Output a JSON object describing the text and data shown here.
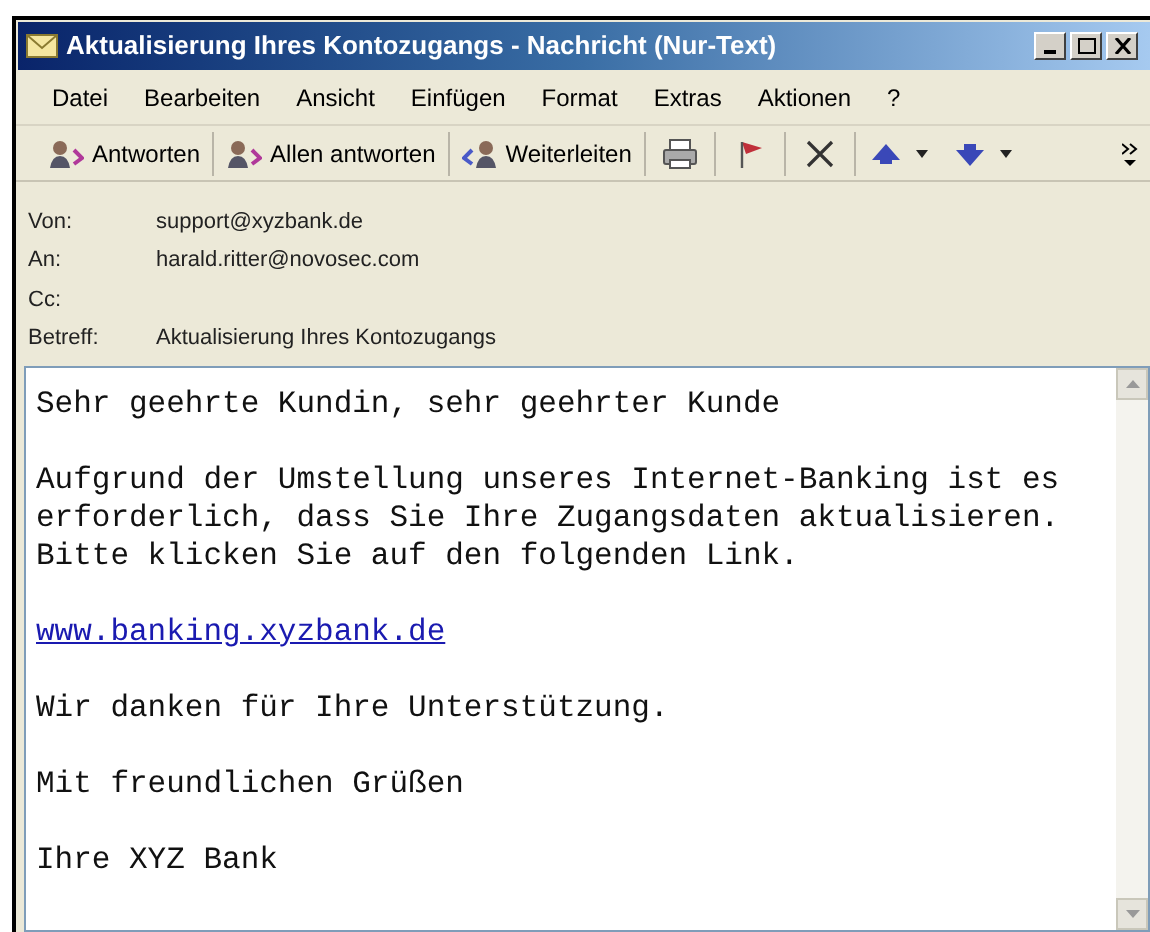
{
  "window": {
    "title": "Aktualisierung Ihres Kontozugangs - Nachricht (Nur-Text)"
  },
  "menu": [
    "Datei",
    "Bearbeiten",
    "Ansicht",
    "Einfügen",
    "Format",
    "Extras",
    "Aktionen",
    "?"
  ],
  "toolbar": [
    {
      "kind": "text",
      "label": "Antworten"
    },
    {
      "kind": "text",
      "label": "Allen antworten"
    },
    {
      "kind": "text",
      "label": "Weiterleiten"
    },
    {
      "kind": "icon"
    },
    {
      "kind": "icon"
    },
    {
      "kind": "icon"
    },
    {
      "kind": "dropdown"
    },
    {
      "kind": "dropdown"
    }
  ],
  "headers": [
    {
      "label": "Von:",
      "value": "support@xyzbank.de"
    },
    {
      "label": "An:",
      "value": "harald.ritter@novosec.com"
    },
    {
      "label": "Cc:"
    },
    {
      "label": "Betreff:",
      "value": "Aktualisierung Ihres Kontozugangs"
    }
  ],
  "body": [
    {
      "kind": "text",
      "text": "Sehr geehrte Kundin, sehr geehrter Kunde"
    },
    {
      "kind": "text",
      "text": "Aufgrund der Umstellung unseres Internet-Banking ist es erforderlich, dass Sie Ihre Zugangsdaten aktualisieren. Bitte klicken Sie auf den folgenden Link."
    },
    {
      "kind": "link",
      "text": "www.banking.xyzbank.de"
    },
    {
      "kind": "text",
      "text": "Wir danken für Ihre Unterstützung."
    },
    {
      "kind": "text",
      "text": "Mit freundlichen Grüßen"
    },
    {
      "kind": "text",
      "text": "Ihre XYZ Bank"
    }
  ]
}
